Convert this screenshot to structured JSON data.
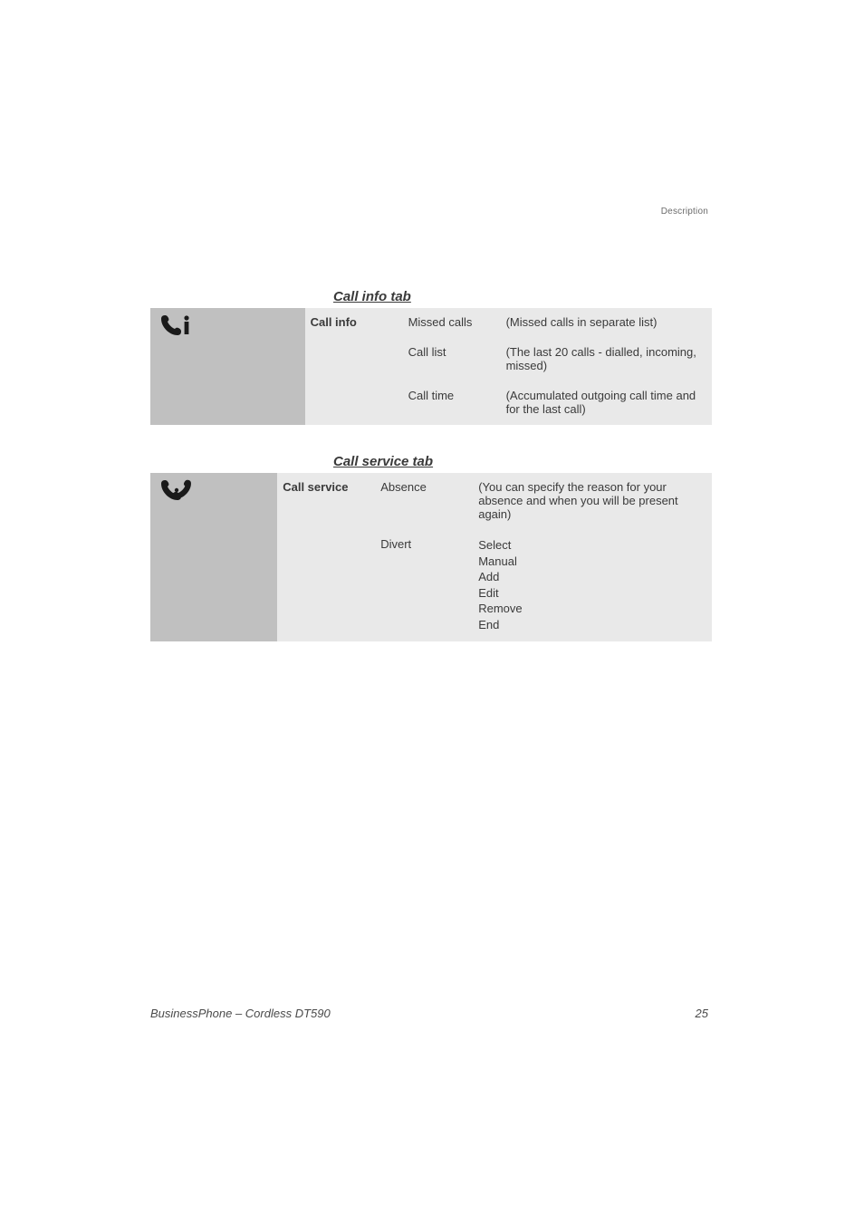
{
  "header_right": "Description",
  "section1": {
    "title": "Call info tab",
    "table_label": "Call info",
    "rows": [
      {
        "item": "Missed calls",
        "desc": "(Missed calls in separate list)"
      },
      {
        "item": "Call list",
        "desc": "(The last 20 calls - dialled, incoming, missed)"
      },
      {
        "item": "Call time",
        "desc": "(Accumulated outgoing call time and for the last call)"
      }
    ]
  },
  "section2": {
    "title": "Call service tab",
    "table_label": "Call service",
    "rows": [
      {
        "item": "Absence",
        "desc": "(You can specify the reason for your absence and when you will be present again)"
      },
      {
        "item": "Divert",
        "list": [
          "Select",
          "Manual",
          "Add",
          "Edit",
          "Remove",
          "End"
        ]
      }
    ]
  },
  "footer_left": "BusinessPhone – Cordless DT590",
  "footer_right": "25"
}
